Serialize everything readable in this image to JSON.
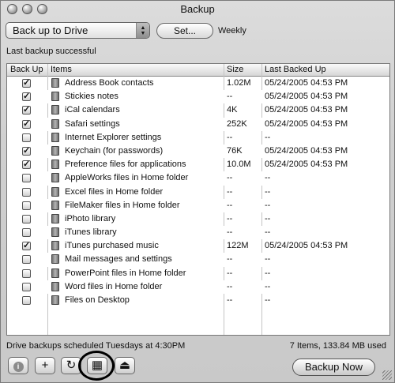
{
  "window": {
    "title": "Backup"
  },
  "toolbar": {
    "destination_value": "Back up to Drive",
    "set_label": "Set...",
    "schedule_text": "Weekly"
  },
  "status_text": "Last backup successful",
  "table": {
    "headers": {
      "backup": "Back Up",
      "items": "Items",
      "size": "Size",
      "last_backed_up": "Last Backed Up"
    },
    "rows": [
      {
        "checked": true,
        "name": "Address Book contacts",
        "size": "1.02M",
        "date": "05/24/2005 04:53 PM"
      },
      {
        "checked": true,
        "name": "Stickies notes",
        "size": "--",
        "date": "05/24/2005 04:53 PM"
      },
      {
        "checked": true,
        "name": "iCal calendars",
        "size": "4K",
        "date": "05/24/2005 04:53 PM"
      },
      {
        "checked": true,
        "name": "Safari settings",
        "size": "252K",
        "date": "05/24/2005 04:53 PM"
      },
      {
        "checked": false,
        "name": "Internet Explorer settings",
        "size": "--",
        "date": "--"
      },
      {
        "checked": true,
        "name": "Keychain (for passwords)",
        "size": "76K",
        "date": "05/24/2005 04:53 PM"
      },
      {
        "checked": true,
        "name": "Preference files for applications",
        "size": "10.0M",
        "date": "05/24/2005 04:53 PM"
      },
      {
        "checked": false,
        "name": "AppleWorks files in Home folder",
        "size": "--",
        "date": "--"
      },
      {
        "checked": false,
        "name": "Excel files in Home folder",
        "size": "--",
        "date": "--"
      },
      {
        "checked": false,
        "name": "FileMaker files in Home folder",
        "size": "--",
        "date": "--"
      },
      {
        "checked": false,
        "name": "iPhoto library",
        "size": "--",
        "date": "--"
      },
      {
        "checked": false,
        "name": "iTunes library",
        "size": "--",
        "date": "--"
      },
      {
        "checked": true,
        "name": "iTunes purchased music",
        "size": "122M",
        "date": "05/24/2005 04:53 PM"
      },
      {
        "checked": false,
        "name": "Mail messages and settings",
        "size": "--",
        "date": "--"
      },
      {
        "checked": false,
        "name": "PowerPoint files in Home folder",
        "size": "--",
        "date": "--"
      },
      {
        "checked": false,
        "name": "Word files in Home folder",
        "size": "--",
        "date": "--"
      },
      {
        "checked": false,
        "name": "Files on Desktop",
        "size": "--",
        "date": "--"
      }
    ]
  },
  "footer": {
    "schedule_note": "Drive backups scheduled Tuesdays at 4:30PM",
    "summary": "7 Items, 133.84 MB used"
  },
  "buttons": {
    "info_glyph": "i",
    "add_glyph": "+",
    "refresh_glyph": "↻",
    "calendar_glyph": "▦",
    "eject_glyph": "⏏",
    "backup_now_label": "Backup Now"
  }
}
